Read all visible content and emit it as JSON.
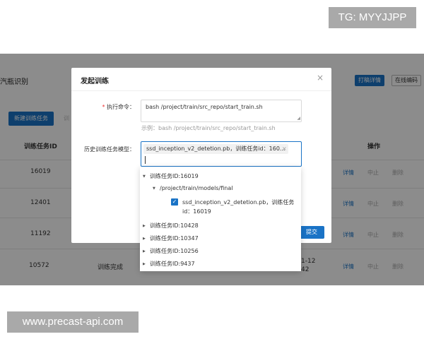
{
  "watermarks": {
    "top": "TG: MYYJJPP",
    "bottom": "www.precast-api.com"
  },
  "header": {
    "title": "汽瓶识别",
    "btn_log": "打稿详情",
    "btn_online": "在线编码"
  },
  "toolbar": {
    "new_task": "新建训练任务",
    "second": "训"
  },
  "table": {
    "col_id": "训练任务ID",
    "col_op": "操作",
    "rows": [
      {
        "id": "16019",
        "status": "",
        "time": "",
        "op1": "详情",
        "op2": "中止",
        "op3": "删除"
      },
      {
        "id": "12401",
        "status": "",
        "time": "",
        "op1": "详情",
        "op2": "中止",
        "op3": "删除"
      },
      {
        "id": "11192",
        "status": "",
        "time": "",
        "op1": "详情",
        "op2": "中止",
        "op3": "删除"
      },
      {
        "id": "10572",
        "status": "训练完成",
        "time": "1-12",
        "time2": "42",
        "op1": "详情",
        "op2": "中止",
        "op3": "删除"
      }
    ]
  },
  "modal": {
    "title": "发起训练",
    "close": "×",
    "cmd_required": "*",
    "cmd_label": "执行命令：",
    "cmd_value": "bash /project/train/src_repo/start_train.sh",
    "cmd_example": "示例：bash /project/train/src_repo/start_train.sh",
    "hist_label": "历史训练任务模型：",
    "hist_tag": "ssd_inception_v2_detetion.pb，训练任务id：160...",
    "hist_tag_close": "×",
    "submit": "提交"
  },
  "tree": {
    "n1": "训练任务ID:16019",
    "n1_path": "/project/train/models/final",
    "n1_leaf": "ssd_inception_v2_detetion.pb，训练任务id：16019",
    "n2": "训练任务ID:10428",
    "n3": "训练任务ID:10347",
    "n4": "训练任务ID:10256",
    "n5": "训练任务ID:9437"
  },
  "icons": {
    "expanded": "▼",
    "collapsed": "▶",
    "check": "✓"
  },
  "colors": {
    "primary": "#1a73c6",
    "overlay": "rgba(0,0,0,0.45)"
  }
}
